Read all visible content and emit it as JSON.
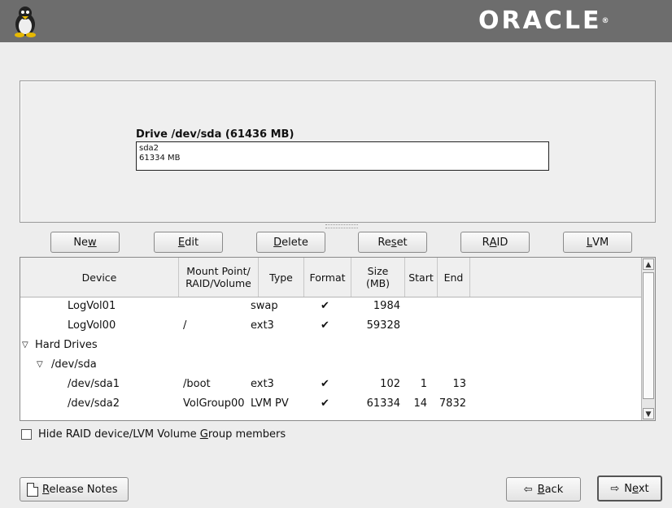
{
  "header": {
    "brand": "ORACLE",
    "brand_mark": "®",
    "icons": [
      "tux-penguin-icon"
    ]
  },
  "drive": {
    "title": "Drive /dev/sda (61436 MB)",
    "partition_name": "sda2",
    "partition_size": "61334 MB"
  },
  "buttons": {
    "new": {
      "pre": "Ne",
      "key": "w",
      "post": ""
    },
    "edit": {
      "pre": "",
      "key": "E",
      "post": "dit"
    },
    "delete": {
      "pre": "",
      "key": "D",
      "post": "elete"
    },
    "reset": {
      "pre": "Re",
      "key": "s",
      "post": "et"
    },
    "raid": {
      "pre": "R",
      "key": "A",
      "post": "ID"
    },
    "lvm": {
      "pre": "",
      "key": "L",
      "post": "VM"
    }
  },
  "table": {
    "headers": {
      "device": "Device",
      "mount_1": "Mount Point/",
      "mount_2": "RAID/Volume",
      "type": "Type",
      "format": "Format",
      "size_1": "Size",
      "size_2": "(MB)",
      "start": "Start",
      "end": "End"
    },
    "rows": [
      {
        "device": "LogVol01",
        "mount": "",
        "type": "swap",
        "format": "✔",
        "size": "1984",
        "start": "",
        "end": ""
      },
      {
        "device": "LogVol00",
        "mount": "/",
        "type": "ext3",
        "format": "✔",
        "size": "59328",
        "start": "",
        "end": ""
      },
      {
        "device": "Hard Drives",
        "mount": "",
        "type": "",
        "format": "",
        "size": "",
        "start": "",
        "end": ""
      },
      {
        "device": "/dev/sda",
        "mount": "",
        "type": "",
        "format": "",
        "size": "",
        "start": "",
        "end": ""
      },
      {
        "device": "/dev/sda1",
        "mount": "/boot",
        "type": "ext3",
        "format": "✔",
        "size": "102",
        "start": "1",
        "end": "13"
      },
      {
        "device": "/dev/sda2",
        "mount": "VolGroup00",
        "type": "LVM PV",
        "format": "✔",
        "size": "61334",
        "start": "14",
        "end": "7832"
      }
    ]
  },
  "hide_checkbox": {
    "pre": "Hide RAID device/LVM Volume ",
    "key": "G",
    "post": "roup members",
    "checked": false
  },
  "footer": {
    "release_notes": {
      "pre": "",
      "key": "R",
      "post": "elease Notes"
    },
    "back": {
      "pre": "",
      "key": "B",
      "post": "ack"
    },
    "next": {
      "pre": "N",
      "key": "e",
      "post": "xt"
    }
  },
  "colors": {
    "topbar": "#6d6d6d",
    "background": "#ededed"
  }
}
